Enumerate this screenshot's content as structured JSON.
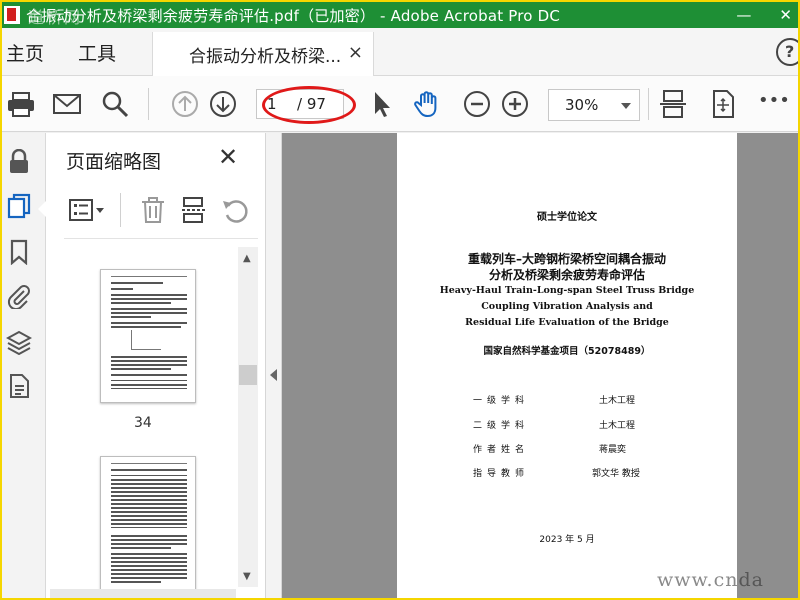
{
  "window": {
    "title": "合振动分析及桥梁剩余疲劳寿命评估.pdf（已加密） - Adobe Acrobat Pro DC",
    "minimize": "—",
    "close": "✕",
    "watermark": "道桥网"
  },
  "menu": {
    "home": "主页",
    "tools": "工具",
    "doc_tab": "合振动分析及桥梁...",
    "tab_close": "×",
    "help": "?"
  },
  "toolbar": {
    "page_current": "1",
    "page_total": "/ 97",
    "zoom": "30%",
    "more": "•••"
  },
  "thumbnails": {
    "title": "页面缩略图",
    "close": "✕",
    "pages": [
      {
        "label": "34"
      },
      {
        "label": ""
      }
    ]
  },
  "document": {
    "degree": "硕士学位论文",
    "title_cn_line1": "重载列车–大跨钢桁梁桥空间耦合振动",
    "title_cn_line2": "分析及桥梁剩余疲劳寿命评估",
    "title_en_line1": "Heavy-Haul Train-Long-span Steel Truss Bridge",
    "title_en_line2": "Coupling Vibration Analysis and",
    "title_en_line3": "Residual Life Evaluation of the Bridge",
    "fund": "国家自然科学基金项目（52078489）",
    "info": [
      {
        "key": "一级学科",
        "value": "土木工程"
      },
      {
        "key": "二级学科",
        "value": "土木工程"
      },
      {
        "key": "作者姓名",
        "value": "蒋晨奕"
      },
      {
        "key": "指导教师",
        "value": "郭文华 教授"
      }
    ],
    "date": "2023 年 5 月"
  },
  "watermark_br": "www.cnda",
  "colors": {
    "titlebar": "#1e8f35",
    "outer_frame": "#f5d600",
    "highlight": "#e01919",
    "doc_background": "#8e8e8e"
  },
  "icons": {
    "toolbar": [
      "print-icon",
      "email-icon",
      "search-icon",
      "prev-page-icon",
      "next-page-icon",
      "select-arrow-icon",
      "hand-icon",
      "zoom-out-icon",
      "zoom-in-icon",
      "fit-page-icon",
      "full-screen-icon",
      "more-icon"
    ],
    "rail": [
      "lock-icon",
      "pages-icon",
      "bookmark-icon",
      "attachment-icon",
      "layers-icon",
      "document-icon"
    ],
    "panel": [
      "options-menu-icon",
      "delete-icon",
      "insert-page-icon",
      "rotate-icon"
    ]
  }
}
